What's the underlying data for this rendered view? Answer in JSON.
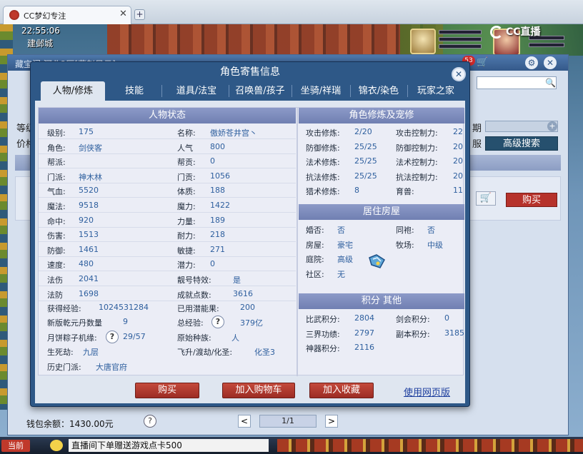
{
  "browser": {
    "tab_title": "CC梦幻专注",
    "tab_close": "✕",
    "new_tab": "+"
  },
  "game": {
    "clock": "22:55:06",
    "location": "建邺城",
    "cc_logo": "CC直播",
    "chat_channel": "当前",
    "chat_text": "直播间下单赠送游戏点卡500"
  },
  "outer": {
    "title": "藏宝阁 河北2区[燕赵风云]",
    "cart_badge": "53",
    "left_label_1": "等级",
    "left_label_2": "价格",
    "right_label_1": "期",
    "right_label_2": "服",
    "advanced_search": "高级搜索",
    "buy": "购买",
    "wallet": "钱包余额：1430.00元",
    "help": "?",
    "page_prev": "<",
    "page_next": ">",
    "page": "1/1"
  },
  "modal": {
    "title": "角色寄售信息",
    "close": "✕",
    "tabs": [
      "人物/修炼",
      "技能",
      "道具/法宝",
      "召唤兽/孩子",
      "坐骑/祥瑞",
      "锦衣/染色",
      "玩家之家"
    ],
    "status_title": "人物状态",
    "cultivation_title": "角色修炼及宠修",
    "house_title": "居住房屋",
    "score_title": "积分 其他",
    "status_left": [
      {
        "label": "级别:",
        "value": "175"
      },
      {
        "label": "角色:",
        "value": "剑侠客"
      },
      {
        "label": "帮派:",
        "value": ""
      },
      {
        "label": "门派:",
        "value": "神木林"
      },
      {
        "label": "气血:",
        "value": "5520"
      },
      {
        "label": "魔法:",
        "value": "9518"
      },
      {
        "label": "命中:",
        "value": "920"
      },
      {
        "label": "伤害:",
        "value": "1513"
      },
      {
        "label": "防御:",
        "value": "1461"
      },
      {
        "label": "速度:",
        "value": "480"
      },
      {
        "label": "法伤",
        "value": "2041"
      },
      {
        "label": "法防",
        "value": "1698"
      }
    ],
    "status_right": [
      {
        "label": "名称:",
        "value": "傲娇苍井宫丶"
      },
      {
        "label": "人气",
        "value": "800"
      },
      {
        "label": "帮贡:",
        "value": "0"
      },
      {
        "label": "门贡:",
        "value": "1056"
      },
      {
        "label": "体质:",
        "value": "188"
      },
      {
        "label": "魔力:",
        "value": "1422"
      },
      {
        "label": "力量:",
        "value": "189"
      },
      {
        "label": "耐力:",
        "value": "218"
      },
      {
        "label": "敏捷:",
        "value": "271"
      },
      {
        "label": "潜力:",
        "value": "0"
      },
      {
        "label": "靓号特效:",
        "value": "是"
      },
      {
        "label": "成就点数:",
        "value": "3616"
      }
    ],
    "extra": {
      "exp_label": "获得经验:",
      "exp_value": "1024531284",
      "pill_label": "新版乾元丹数量",
      "pill_value": "9",
      "moon_label": "月饼粽子机缘:",
      "moon_help": "?",
      "moon_value": "29/57",
      "life_label": "生死劫:",
      "life_value": "九层",
      "hist_label": "历史门派:",
      "hist_value": "大唐官府",
      "used_label": "已用潜能果:",
      "used_value": "200",
      "total_exp_label": "总经验:",
      "total_exp_help": "?",
      "total_exp_value": "379亿",
      "race_label": "原始种族:",
      "race_value": "人",
      "fly_label": "飞升/渡劫/化圣:",
      "fly_value": "化圣3"
    },
    "cultivation": [
      {
        "l1": "攻击修炼:",
        "v1": "2/20",
        "l2": "攻击控制力:",
        "v2": "22"
      },
      {
        "l1": "防御修炼:",
        "v1": "25/25",
        "l2": "防御控制力:",
        "v2": "20"
      },
      {
        "l1": "法术修炼:",
        "v1": "25/25",
        "l2": "法术控制力:",
        "v2": "20"
      },
      {
        "l1": "抗法修炼:",
        "v1": "25/25",
        "l2": "抗法控制力:",
        "v2": "20"
      },
      {
        "l1": "猎术修炼:",
        "v1": "8",
        "l2": "育兽:",
        "v2": "11"
      }
    ],
    "house": [
      {
        "l1": "婚否:",
        "v1": "否",
        "l2": "同袍:",
        "v2": "否"
      },
      {
        "l1": "房屋:",
        "v1": "豪宅",
        "l2": "牧场:",
        "v2": "中级"
      },
      {
        "l1": "庭院:",
        "v1": "高级",
        "l2": "",
        "v2": ""
      },
      {
        "l1": "社区:",
        "v1": "无",
        "l2": "",
        "v2": ""
      }
    ],
    "scores": [
      {
        "l1": "比武积分:",
        "v1": "2804",
        "l2": "剑会积分:",
        "v2": "0"
      },
      {
        "l1": "三界功绩:",
        "v1": "2797",
        "l2": "副本积分:",
        "v2": "3185"
      },
      {
        "l1": "神器积分:",
        "v1": "2116",
        "l2": "",
        "v2": ""
      }
    ],
    "buttons": {
      "buy": "购买",
      "add_cart": "加入购物车",
      "add_fav": "加入收藏",
      "web_version": "使用网页版"
    }
  },
  "colors": {
    "modal_bg": "#2e5887",
    "section_header": "#7d8bbd",
    "value_text": "#2e5f9e",
    "red_button": "#b03a2e"
  }
}
